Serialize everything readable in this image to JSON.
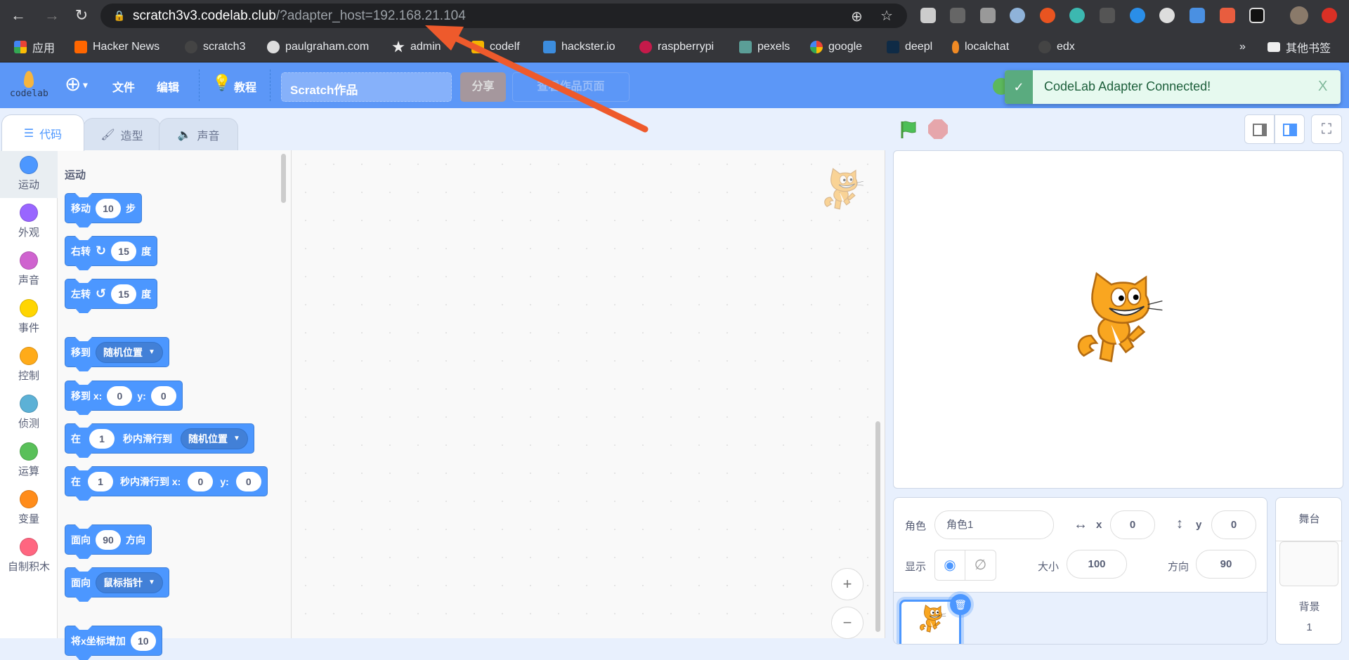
{
  "browser": {
    "url_host": "scratch3v3.codelab.club",
    "url_rest": "/?adapter_host=192.168.21.104",
    "bookmarks": [
      "应用",
      "Hacker News",
      "scratch3",
      "paulgraham.com",
      "admin",
      "codelf",
      "hackster.io",
      "raspberrypi",
      "pexels",
      "google",
      "deepl",
      "localchat",
      "edx"
    ],
    "bookmark_colors": [
      "#4285f4",
      "#ff6600",
      "#444",
      "#ddd",
      "#111",
      "#f4b400",
      "#3c8dde",
      "#c51a4a",
      "#5b9e97",
      "#ffffff",
      "#0f2b46",
      "#f08a24",
      "#444"
    ],
    "overflow": "»",
    "other_bookmarks": "其他书签"
  },
  "menu": {
    "logo": "codelab",
    "language_icon": "globe-icon",
    "file": "文件",
    "edit": "编辑",
    "tutorials": "教程",
    "project_title": "Scratch作品",
    "share": "分享",
    "see_project": "查看作品页面"
  },
  "toast": {
    "message": "CodeLab Adapter Connected!",
    "close": "X",
    "color": "#5aab7f"
  },
  "tabs": [
    {
      "label": "代码",
      "icon": "code-icon",
      "active": true
    },
    {
      "label": "造型",
      "icon": "brush-icon"
    },
    {
      "label": "声音",
      "icon": "speaker-icon"
    }
  ],
  "categories": [
    {
      "label": "运动",
      "color": "#4c97ff"
    },
    {
      "label": "外观",
      "color": "#9966ff"
    },
    {
      "label": "声音",
      "color": "#cf63cf"
    },
    {
      "label": "事件",
      "color": "#ffd500"
    },
    {
      "label": "控制",
      "color": "#ffab19"
    },
    {
      "label": "侦测",
      "color": "#5cb1d6"
    },
    {
      "label": "运算",
      "color": "#59c059"
    },
    {
      "label": "变量",
      "color": "#ff8c1a"
    },
    {
      "label": "自制积木",
      "color": "#ff6680"
    }
  ],
  "palette": {
    "section_title": "运动",
    "blocks": {
      "move": {
        "a": "移动",
        "v": "10",
        "b": "步"
      },
      "turn_right": {
        "a": "右转",
        "v": "15",
        "b": "度"
      },
      "turn_left": {
        "a": "左转",
        "v": "15",
        "b": "度"
      },
      "goto": {
        "a": "移到",
        "dd": "随机位置"
      },
      "goto_xy": {
        "a": "移到 x:",
        "x": "0",
        "yl": "y:",
        "y": "0"
      },
      "glide": {
        "a": "在",
        "v": "1",
        "b": "秒内滑行到",
        "dd": "随机位置"
      },
      "glide_xy": {
        "a": "在",
        "v": "1",
        "b": "秒内滑行到 x:",
        "x": "0",
        "yl": "y:",
        "y": "0"
      },
      "point_dir": {
        "a": "面向",
        "v": "90",
        "b": "方向"
      },
      "point_towards": {
        "a": "面向",
        "dd": "鼠标指针"
      },
      "change_x": {
        "a": "将x坐标增加",
        "v": "10"
      }
    }
  },
  "zoom": {
    "in": "+",
    "out": "−"
  },
  "sprite_info": {
    "sprite_label": "角色",
    "sprite_name": "角色1",
    "x_label": "x",
    "x": "0",
    "y_label": "y",
    "y": "0",
    "show_label": "显示",
    "size_label": "大小",
    "size": "100",
    "direction_label": "方向",
    "direction": "90"
  },
  "stage_selector": {
    "title": "舞台",
    "backdrops_label": "背景",
    "backdrops_count": "1"
  }
}
